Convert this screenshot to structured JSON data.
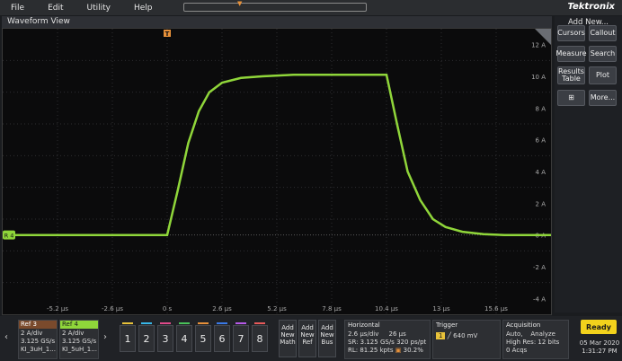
{
  "menu": {
    "items": [
      "File",
      "Edit",
      "Utility",
      "Help"
    ],
    "brand": "Tektronix"
  },
  "waveform": {
    "title": "Waveform View",
    "trigger_marker": "T",
    "channel_marker": "R 4",
    "y_labels": [
      "12 A",
      "10 A",
      "8 A",
      "6 A",
      "4 A",
      "2 A",
      "0 A",
      "-2 A",
      "-4 A"
    ],
    "x_labels": [
      "-5.2 µs",
      "-2.6 µs",
      "0 s",
      "2.6 µs",
      "5.2 µs",
      "7.8 µs",
      "10.4 µs",
      "13 µs",
      "15.6 µs"
    ],
    "trace_color": "#8fd63a"
  },
  "chart_data": {
    "type": "line",
    "title": "",
    "xlabel": "",
    "ylabel": "",
    "x_unit": "µs",
    "y_unit": "A",
    "xlim": [
      -7.8,
      18.2
    ],
    "ylim": [
      -5,
      13
    ],
    "grid": true,
    "series": [
      {
        "x": [
          -7.8,
          0,
          0.5,
          1,
          1.5,
          2,
          2.6,
          3.5,
          4.5,
          6,
          8,
          10.4,
          10.9,
          11.4,
          12,
          12.6,
          13.2,
          14,
          15,
          16,
          18.2
        ],
        "y": [
          0,
          0,
          2.8,
          5.8,
          7.8,
          9.0,
          9.6,
          9.9,
          10.0,
          10.1,
          10.1,
          10.1,
          7.0,
          4.0,
          2.2,
          1.0,
          0.5,
          0.2,
          0.05,
          0,
          0
        ]
      }
    ]
  },
  "side": {
    "title": "Add New...",
    "buttons": [
      "Cursors",
      "Callout",
      "Measure",
      "Search",
      "Results Table",
      "Plot",
      "",
      "More..."
    ]
  },
  "bottom": {
    "ref3": {
      "title": "Ref 3",
      "l1": "2 A/div",
      "l2": "3.125 GS/s",
      "l3": "KI_3uH_1..."
    },
    "ref4": {
      "title": "Ref 4",
      "l1": "2 A/div",
      "l2": "3.125 GS/s",
      "l3": "KI_5uH_1..."
    },
    "channels": [
      "1",
      "2",
      "3",
      "4",
      "5",
      "6",
      "7",
      "8"
    ],
    "channel_colors": [
      "#e8c23a",
      "#38b7e8",
      "#e04a8a",
      "#4ac25a",
      "#e8913a",
      "#3a7ae8",
      "#b75ae8",
      "#e85a5a"
    ],
    "add_math": "Add New Math",
    "add_ref": "Add New Ref",
    "add_bus": "Add New Bus",
    "horizontal": {
      "title": "Horizontal",
      "l1a": "2.6 µs/div",
      "l1b": "26 µs",
      "l2a": "SR: 3.125 GS/s",
      "l2b": "320 ps/pt",
      "l3a": "RL: 81.25 kpts",
      "l3b": "30.2%"
    },
    "trigger": {
      "title": "Trigger",
      "ch": "1",
      "level": "640 mV"
    },
    "acquisition": {
      "title": "Acquisition",
      "l1a": "Auto,",
      "l1b": "Analyze",
      "l2a": "High Res:",
      "l2b": "12 bits",
      "l3": "0 Acqs"
    },
    "status": "Ready",
    "date": "05 Mar 2020",
    "time": "1:31:27 PM"
  }
}
